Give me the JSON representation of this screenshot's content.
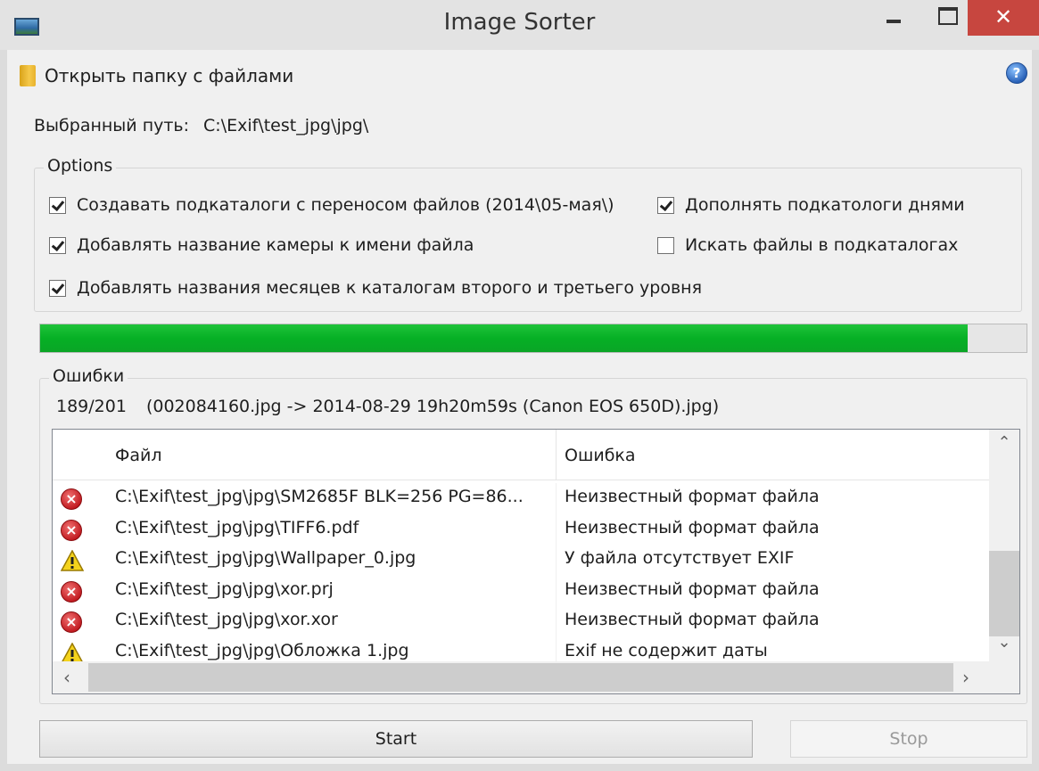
{
  "window": {
    "title": "Image Sorter",
    "close_glyph": "✕",
    "colors": {
      "close": "#c7463f",
      "progress": "#06b025"
    }
  },
  "toolbar": {
    "open_folder_label": "Открыть папку с файлами",
    "help_glyph": "?"
  },
  "path": {
    "label": "Выбранный путь:",
    "value": "C:\\Exif\\test_jpg\\jpg\\"
  },
  "options": {
    "title": "Options",
    "create_subfolders": {
      "label": "Создавать подкаталоги с переносом файлов (2014\\05-мая\\)",
      "checked": true
    },
    "add_days": {
      "label": "Дополнять подкатологи днями",
      "checked": true
    },
    "add_camera": {
      "label": "Добавлять название камеры к имени файла",
      "checked": true
    },
    "search_subfolders": {
      "label": "Искать файлы в подкаталогах",
      "checked": false
    },
    "add_month_names": {
      "label": "Добавлять названия месяцев к каталогам второго и третьего уровня",
      "checked": true
    }
  },
  "progress": {
    "percent": 94
  },
  "errors": {
    "title": "Ошибки",
    "count": "189/201",
    "current": "(002084160.jpg -> 2014-08-29 19h20m59s (Canon EOS 650D).jpg)",
    "columns": {
      "file": "Файл",
      "error": "Ошибка"
    },
    "rows": [
      {
        "icon": "error-icon",
        "file": "C:\\Exif\\test_jpg\\jpg\\SM2685F BLK=256 PG=86...",
        "error": "Неизвестный формат файла"
      },
      {
        "icon": "error-icon",
        "file": "C:\\Exif\\test_jpg\\jpg\\TIFF6.pdf",
        "error": "Неизвестный формат файла"
      },
      {
        "icon": "warning-icon",
        "file": "C:\\Exif\\test_jpg\\jpg\\Wallpaper_0.jpg",
        "error": "У файла отсутствует EXIF"
      },
      {
        "icon": "error-icon",
        "file": "C:\\Exif\\test_jpg\\jpg\\xor.prj",
        "error": "Неизвестный формат файла"
      },
      {
        "icon": "error-icon",
        "file": "C:\\Exif\\test_jpg\\jpg\\xor.xor",
        "error": "Неизвестный формат файла"
      },
      {
        "icon": "warning-icon",
        "file": "C:\\Exif\\test_jpg\\jpg\\Обложка 1.jpg",
        "error": "Exif не содержит даты"
      }
    ]
  },
  "buttons": {
    "start": "Start",
    "stop": "Stop"
  }
}
